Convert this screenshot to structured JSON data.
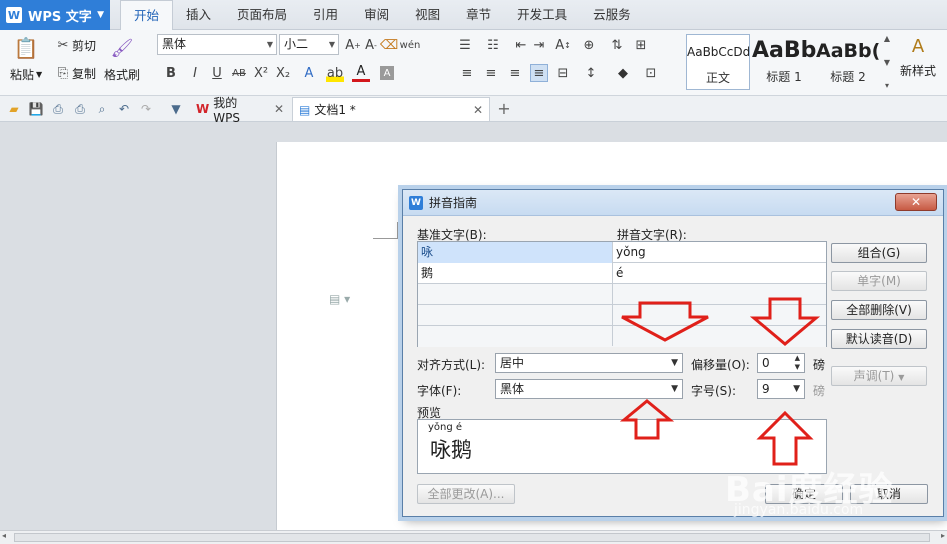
{
  "app": {
    "name": "WPS 文字"
  },
  "menu": [
    "开始",
    "插入",
    "页面布局",
    "引用",
    "审阅",
    "视图",
    "章节",
    "开发工具",
    "云服务"
  ],
  "ribbon": {
    "paste": "粘贴",
    "cut": "剪切",
    "copy": "复制",
    "format_painter": "格式刷",
    "font_name": "黑体",
    "font_size": "小二",
    "new_style": "新样式",
    "styles": [
      {
        "preview": "AaBbCcDd",
        "label": "正文"
      },
      {
        "preview": "AaBb",
        "label": "标题 1"
      },
      {
        "preview": "AaBb(",
        "label": "标题 2"
      }
    ]
  },
  "doc_tabs": [
    {
      "label": "我的WPS"
    },
    {
      "label": "文档1 *"
    }
  ],
  "dialog": {
    "title": "拼音指南",
    "base_text_label": "基准文字(B):",
    "ruby_text_label": "拼音文字(R):",
    "rows": [
      {
        "base": "咏",
        "ruby": "yǒng"
      },
      {
        "base": "鹅",
        "ruby": "é"
      }
    ],
    "buttons": {
      "group": "组合(G)",
      "single": "单字(M)",
      "clear_all": "全部删除(V)",
      "default_reading": "默认读音(D)",
      "tone": "声调(T)",
      "apply_all": "全部更改(A)...",
      "ok": "确定",
      "cancel": "取消"
    },
    "align_label": "对齐方式(L):",
    "align_value": "居中",
    "offset_label": "偏移量(O):",
    "offset_value": "0",
    "offset_unit": "磅",
    "font_label": "字体(F):",
    "font_value": "黑体",
    "size_label": "字号(S):",
    "size_value": "9",
    "size_unit": "磅",
    "preview_label": "预览",
    "preview_pinyin": "yǒng  é",
    "preview_text": "咏鹅"
  },
  "watermark": {
    "main": "Bai度经验",
    "sub": "jingyan.baidu.com"
  },
  "colors": {
    "accent": "#2f7ed8",
    "arrow": "#e0201a"
  }
}
